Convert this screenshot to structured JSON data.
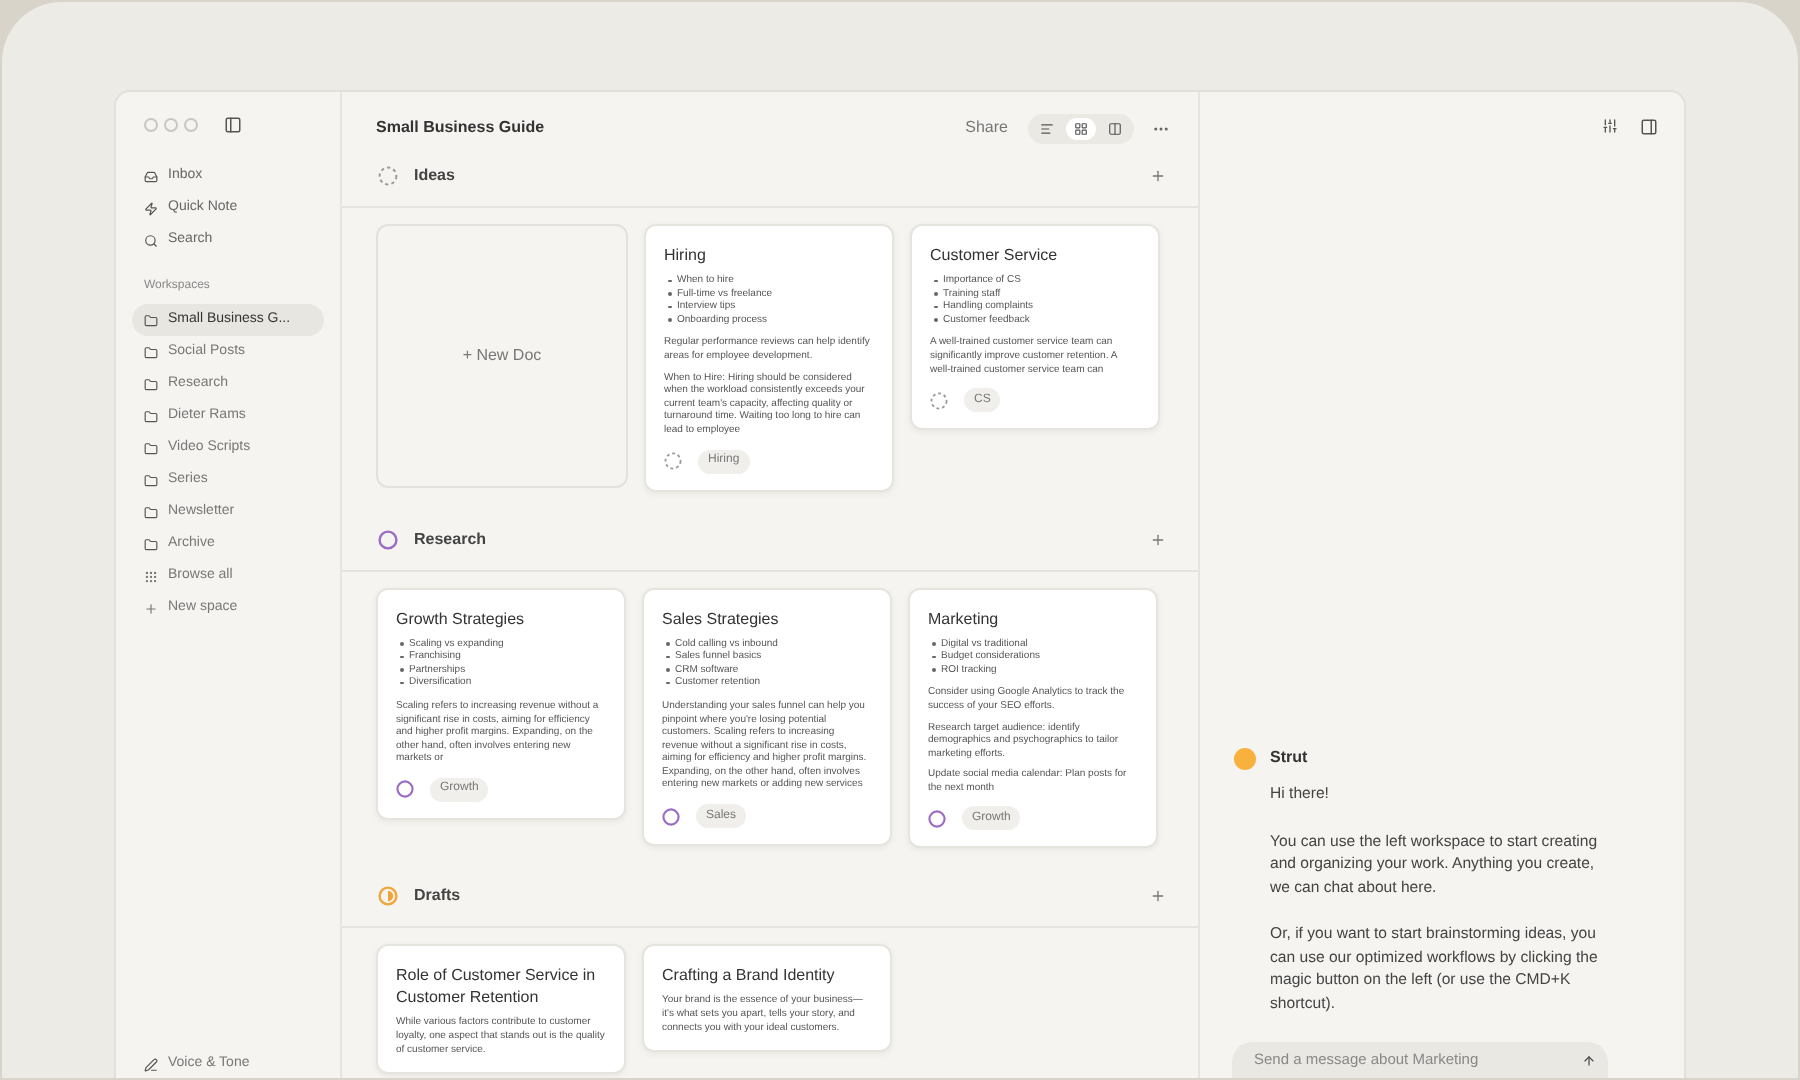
{
  "sidebar": {
    "nav": [
      {
        "label": "Inbox"
      },
      {
        "label": "Quick Note"
      },
      {
        "label": "Search"
      }
    ],
    "workspaces_heading": "Workspaces",
    "workspaces": [
      {
        "label": "Small Business G...",
        "selected": true
      },
      {
        "label": "Social Posts",
        "selected": false
      },
      {
        "label": "Research",
        "selected": false
      },
      {
        "label": "Dieter Rams",
        "selected": false
      },
      {
        "label": "Video Scripts",
        "selected": false
      },
      {
        "label": "Series",
        "selected": false
      },
      {
        "label": "Newsletter",
        "selected": false
      },
      {
        "label": "Archive",
        "selected": false
      }
    ],
    "browse_all": "Browse all",
    "new_space": "New space",
    "footer": "Voice & Tone"
  },
  "header": {
    "title": "Small Business Guide",
    "share": "Share",
    "views": [
      {
        "selected": false
      },
      {
        "selected": true
      },
      {
        "selected": false
      }
    ]
  },
  "new_doc": "+ New Doc",
  "sections": [
    {
      "title": "Ideas",
      "kind": "dashed",
      "color": "#9a9a9a",
      "cards": [
        {
          "title": "Hiring",
          "bullets": [
            "When to hire",
            "Full-time vs freelance",
            "Interview tips",
            "Onboarding process"
          ],
          "paragraphs": [
            "Regular performance reviews can help identify areas for employee development.",
            "When to Hire: Hiring should be considered when the workload consistently exceeds your current team's capacity, affecting quality or turnaround time. Waiting too long to hire can lead to employee"
          ],
          "tag": "Hiring"
        },
        {
          "title": "Customer Service",
          "bullets": [
            "Importance of CS",
            "Training staff",
            "Handling complaints",
            "Customer feedback"
          ],
          "paragraphs": [
            "A well-trained customer service team can significantly improve customer retention. A well-trained customer service team can"
          ],
          "tag": "CS"
        }
      ]
    },
    {
      "title": "Research",
      "kind": "circle",
      "color": "#9b6cc4",
      "cards": [
        {
          "title": "Growth Strategies",
          "bullets": [
            "Scaling vs expanding",
            "Franchising",
            "Partnerships",
            "Diversification"
          ],
          "paragraphs": [
            "Scaling refers to increasing revenue without a significant rise in costs, aiming for efficiency and higher profit margins. Expanding, on the other hand, often involves entering new markets or"
          ],
          "tag": "Growth"
        },
        {
          "title": "Sales Strategies",
          "bullets": [
            "Cold calling vs inbound",
            "Sales funnel basics",
            "CRM software",
            "Customer retention"
          ],
          "paragraphs": [
            "Understanding your sales funnel can help you pinpoint where you're losing potential customers. Scaling refers to increasing revenue without a significant rise in costs, aiming for efficiency and higher profit margins. Expanding, on the other hand, often involves entering new markets or adding new services"
          ],
          "tag": "Sales"
        },
        {
          "title": "Marketing",
          "bullets": [
            "Digital vs traditional",
            "Budget considerations",
            "ROI tracking"
          ],
          "paragraphs": [
            "Consider using Google Analytics to track the success of your SEO efforts.",
            "Research target audience: identify demographics and psychographics to tailor marketing efforts.",
            "Update social media calendar: Plan posts for the next month"
          ],
          "tag": "Growth"
        }
      ]
    },
    {
      "title": "Drafts",
      "kind": "half",
      "color": "#f0a63a",
      "cards": [
        {
          "title": "Role of Customer Service in Customer Retention",
          "paragraphs": [
            "While various factors contribute to customer loyalty, one aspect that stands out is the quality of customer service."
          ]
        },
        {
          "title": "Crafting a Brand Identity",
          "paragraphs": [
            "Your brand is the essence of your business—it's what sets you apart, tells your story, and connects you with your ideal customers."
          ]
        }
      ]
    }
  ],
  "chat": {
    "sender": "Strut",
    "messages": [
      "Hi there!",
      "You can use the left workspace to start creating and organizing your work. Anything you create, we can chat about here.",
      "Or, if you want to start brainstorming ideas, you can use our optimized workflows by clicking the magic button on the left (or use the CMD+K shortcut)."
    ],
    "placeholder": "Send a message about Marketing"
  }
}
